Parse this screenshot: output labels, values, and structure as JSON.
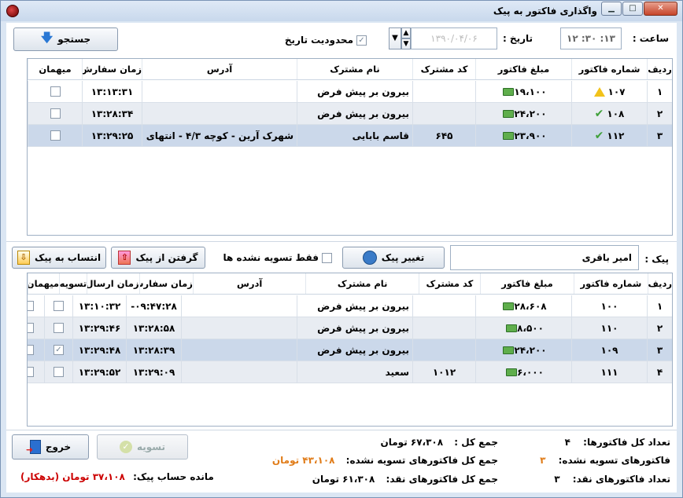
{
  "window": {
    "title": "واگذاری فاکتور به پیک"
  },
  "top": {
    "time_label": "ساعت :",
    "time_value": "۱۲ :۳۰ :۱۳",
    "date_label": "تاریخ :",
    "date_value": "۱۳۹۰/۰۴/۰۶",
    "date_limit_label": "محدودیت تاریخ",
    "search_label": "جستجو"
  },
  "grid1": {
    "headers": [
      "ردیف",
      "شماره فاکتور",
      "مبلغ فاکتور",
      "کد مشترک",
      "نام مشترک",
      "آدرس",
      "زمان سفارش",
      "میهمان"
    ],
    "rows": [
      {
        "n": "۱",
        "invoice": "۱۰۷",
        "amount": "۱۹،۱۰۰",
        "code": "",
        "name": "بیرون بر پیش فرض",
        "address": "",
        "time": "۱۳:۱۳:۳۱",
        "status": "warn"
      },
      {
        "n": "۲",
        "invoice": "۱۰۸",
        "amount": "۲۴،۲۰۰",
        "code": "",
        "name": "بیرون بر پیش فرض",
        "address": "",
        "time": "۱۳:۲۸:۳۴",
        "status": "ok"
      },
      {
        "n": "۳",
        "invoice": "۱۱۲",
        "amount": "۲۳،۹۰۰",
        "code": "۶۴۵",
        "name": "قاسم بابایی",
        "address": "شهرک آرین - کوچه ۴/۳ - انتهای",
        "time": "۱۳:۲۹:۲۵",
        "status": "ok"
      }
    ]
  },
  "middle": {
    "courier_label": "پیک :",
    "courier_value": "امیر باقری",
    "change_courier": "تغییر پیک",
    "only_unsettled": "فقط تسویه نشده ها",
    "take_from_courier": "گرفتن از پیک",
    "assign_to_courier": "انتساب به پیک"
  },
  "grid2": {
    "headers": [
      "ردیف",
      "شماره فاکتور",
      "مبلغ فاکتور",
      "کد مشترک",
      "نام مشترک",
      "آدرس",
      "زمان سفارش",
      "زمان ارسال",
      "تسویه",
      "میهمان"
    ],
    "rows": [
      {
        "n": "۱",
        "invoice": "۱۰۰",
        "amount": "۲۸،۶۰۸",
        "code": "",
        "name": "بیرون بر پیش فرض",
        "address": "",
        "order_time": "۰۹:۴۷:۲۸-",
        "send_time": "۱۳:۱۰:۳۲",
        "settled": false
      },
      {
        "n": "۲",
        "invoice": "۱۱۰",
        "amount": "۸،۵۰۰",
        "code": "",
        "name": "بیرون بر پیش فرض",
        "address": "",
        "order_time": "۱۳:۲۸:۵۸",
        "send_time": "۱۳:۲۹:۴۶",
        "settled": false
      },
      {
        "n": "۳",
        "invoice": "۱۰۹",
        "amount": "۲۴،۲۰۰",
        "code": "",
        "name": "بیرون بر پیش فرض",
        "address": "",
        "order_time": "۱۳:۲۸:۳۹",
        "send_time": "۱۳:۲۹:۴۸",
        "settled": true
      },
      {
        "n": "۴",
        "invoice": "۱۱۱",
        "amount": "۶،۰۰۰",
        "code": "۱۰۱۲",
        "name": "سعید",
        "address": "",
        "order_time": "۱۳:۲۹:۰۹",
        "send_time": "۱۳:۲۹:۵۲",
        "settled": false
      }
    ]
  },
  "footer": {
    "total_count_label": "تعداد کل فاکتورها:",
    "total_count": "۴",
    "unsettled_count_label": "فاکتورهای تسویه نشده:",
    "unsettled_count": "۳",
    "cash_count_label": "تعداد فاکتورهای نقد:",
    "cash_count": "۳",
    "sum_label": "جمع کل :",
    "sum": "۶۷،۳۰۸ تومان",
    "unsettled_sum_label": "جمع کل فاکتورهای تسویه نشده:",
    "unsettled_sum": "۴۳،۱۰۸ تومان",
    "cash_sum_label": "جمع کل فاکتورهای نقد:",
    "cash_sum": "۶۱،۳۰۸ تومان",
    "balance_label": "مانده حساب پیک:",
    "balance": "۳۷،۱۰۸ تومان (بدهکار)",
    "settle_button": "تسویه",
    "exit_button": "خروج"
  },
  "colors": {
    "orange": "#e07b17",
    "red": "#cc0000",
    "selected_row": "#cbd8ea"
  }
}
